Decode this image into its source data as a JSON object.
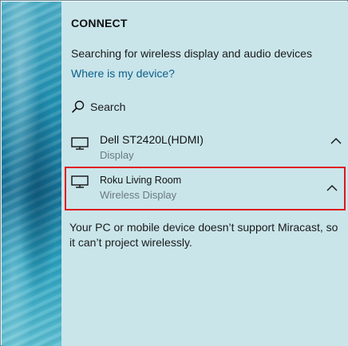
{
  "panel": {
    "title": "CONNECT",
    "status": "Searching for wireless display and audio devices",
    "help_link": "Where is my device?",
    "search_label": "Search"
  },
  "devices": [
    {
      "name": "Dell ST2420L(HDMI)",
      "type": "Display",
      "icon": "monitor-icon",
      "expanded_icon": "chevron-up-icon"
    },
    {
      "name": "Roku Living Room",
      "type": "Wireless Display",
      "icon": "monitor-icon",
      "expanded_icon": "chevron-up-icon",
      "highlighted": true
    }
  ],
  "message": "Your PC or mobile device doesn’t support Miracast, so it can’t project wirelessly.",
  "colors": {
    "panel_bg": "#c9e5ea",
    "link": "#0b5f8a",
    "highlight": "#e0151d"
  }
}
